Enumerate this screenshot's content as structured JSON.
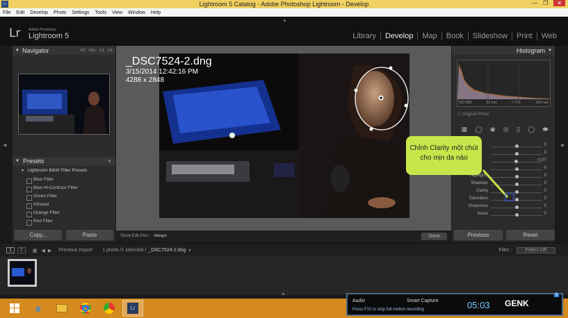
{
  "window": {
    "title": "Lightroom 5 Catalog - Adobe Photoshop Lightroom - Develop",
    "logo": "Lr"
  },
  "menu": [
    "File",
    "Edit",
    "Develop",
    "Photo",
    "Settings",
    "Tools",
    "View",
    "Window",
    "Help"
  ],
  "brand": {
    "mark": "Lr",
    "sub": "Adobe Photoshop",
    "product": "Lightroom 5"
  },
  "modules": [
    "Library",
    "Develop",
    "Map",
    "Book",
    "Slideshow",
    "Print",
    "Web"
  ],
  "navigator": {
    "title": "Navigator",
    "options": [
      "FIT",
      "FILL",
      "1:1",
      "3:1"
    ]
  },
  "presets": {
    "title": "Presets",
    "group": "Lightroom B&W Filter Presets",
    "items": [
      "Blue Filter",
      "Blue Hi-Contrast Filter",
      "Green Filter",
      "Infrared",
      "Orange Filter",
      "Red Filter"
    ]
  },
  "left_buttons": {
    "copy": "Copy...",
    "paste": "Paste"
  },
  "photo": {
    "filename": "_DSC7524-2.dng",
    "date": "3/15/2014 12:42:16 PM",
    "dims": "4288 x 2848"
  },
  "toolbar": {
    "label": "Show Edit Pins :",
    "value": "Always",
    "done": "Done"
  },
  "histogram": {
    "title": "Histogram",
    "original": "Original Photo",
    "readouts": [
      "ISO 800",
      "50 mm",
      "f / 4.5",
      "1/50 sec"
    ]
  },
  "tooltip": "Chỉnh Clarity một chút cho mịn da nào",
  "sliders": [
    {
      "label": "",
      "value": "0",
      "level": 0.5
    },
    {
      "label": "",
      "value": "0",
      "level": 0.5
    },
    {
      "label": "",
      "value": "- 0.07",
      "level": 0.49
    },
    {
      "label": "",
      "value": "0",
      "level": 0.5
    },
    {
      "label": "Highlights",
      "value": "0",
      "level": 0.5
    },
    {
      "label": "Shadows",
      "value": "0",
      "level": 0.5
    },
    {
      "label": "Clarity",
      "value": "0",
      "level": 0.5
    },
    {
      "label": "Saturation",
      "value": "0",
      "level": 0.5
    },
    {
      "label": "Sharpness",
      "value": "0",
      "level": 0.5
    },
    {
      "label": "Noise",
      "value": "0",
      "level": 0.5
    }
  ],
  "right_buttons": {
    "previous": "Previous",
    "reset": "Reset"
  },
  "filmbar": {
    "pages": [
      "1",
      "2"
    ],
    "previous": "Previous Import",
    "status": "1 photo /1 selected /",
    "file": "_DSC7524-2.dng",
    "filter_label": "Filter :",
    "filter_value": "Filters Off"
  },
  "taskbar_apps": [
    "windows-start",
    "ie",
    "explorer",
    "chrome",
    "chrome-alt",
    "lightroom"
  ],
  "capture": {
    "audio": "Audio",
    "smart": "Smart Capture",
    "hint": "Press F10 to stop full motion recording",
    "clock": "05:03",
    "brand": "GENK",
    "badge": "5"
  },
  "colors": {
    "titlebar": "#f0d060",
    "tooltip": "#c8e64a",
    "taskbar": "#d48a1e"
  }
}
